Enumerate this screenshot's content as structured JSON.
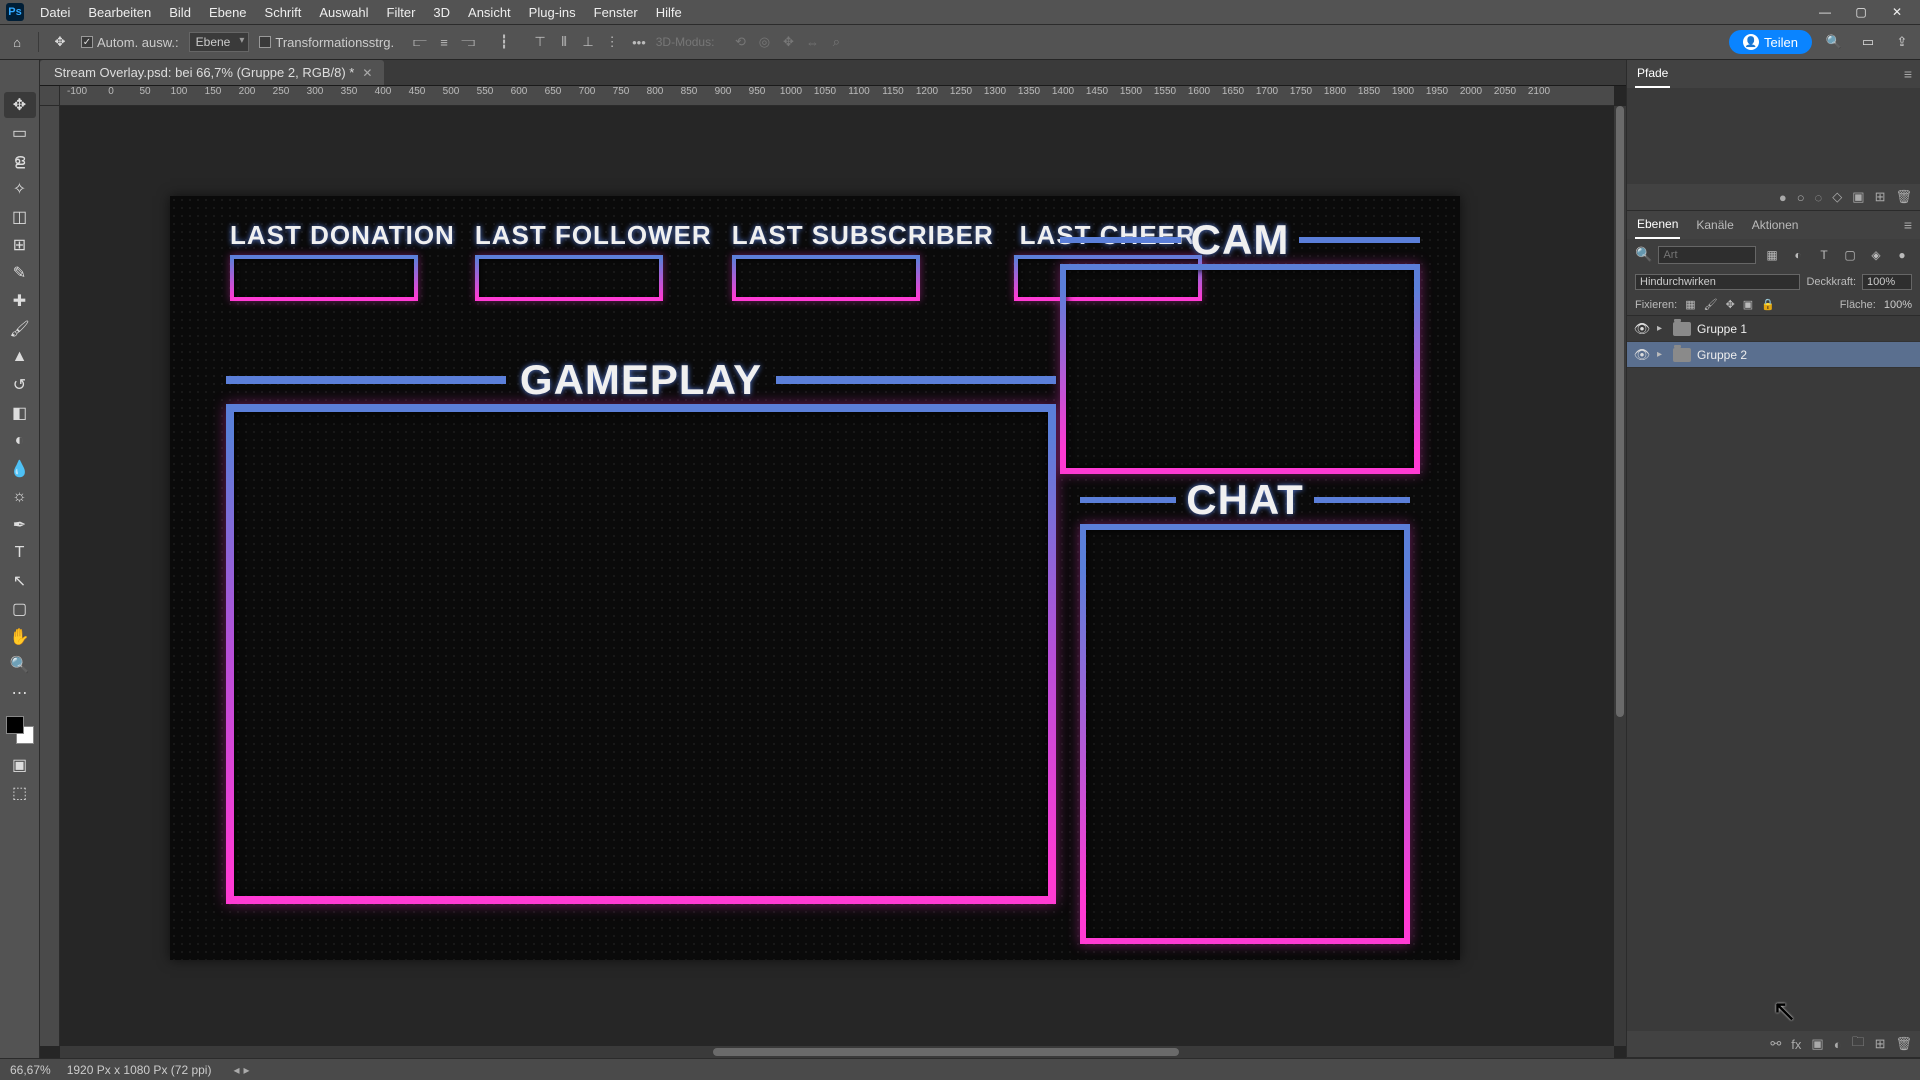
{
  "menubar": {
    "items": [
      "Datei",
      "Bearbeiten",
      "Bild",
      "Ebene",
      "Schrift",
      "Auswahl",
      "Filter",
      "3D",
      "Ansicht",
      "Plug-ins",
      "Fenster",
      "Hilfe"
    ]
  },
  "optbar": {
    "auto_select_label": "Autom. ausw.:",
    "auto_select_value": "Ebene",
    "transform_label": "Transformationsstrg.",
    "mode_3d": "3D-Modus:"
  },
  "share_label": "Teilen",
  "doc_tab": "Stream Overlay.psd: bei 66,7% (Gruppe 2, RGB/8) *",
  "ruler_marks": [
    "-100",
    "0",
    "50",
    "100",
    "150",
    "200",
    "250",
    "300",
    "350",
    "400",
    "450",
    "500",
    "550",
    "600",
    "650",
    "700",
    "750",
    "800",
    "850",
    "900",
    "950",
    "1000",
    "1050",
    "1100",
    "1150",
    "1200",
    "1250",
    "1300",
    "1350",
    "1400",
    "1450",
    "1500",
    "1550",
    "1600",
    "1650",
    "1700",
    "1750",
    "1800",
    "1850",
    "1900",
    "1950",
    "2000",
    "2050",
    "2100"
  ],
  "overlay": {
    "info": [
      "LAST DONATION",
      "LAST FOLLOWER",
      "LAST SUBSCRIBER",
      "LAST CHEER"
    ],
    "gameplay": "GAMEPLAY",
    "cam": "CAM",
    "chat": "CHAT"
  },
  "panels": {
    "paths_tab": "Pfade",
    "layers_tabs": [
      "Ebenen",
      "Kanäle",
      "Aktionen"
    ],
    "filter_placeholder": "Art",
    "blend_mode": "Hindurchwirken",
    "opacity_label": "Deckkraft:",
    "opacity_value": "100%",
    "fill_label": "Fläche:",
    "fill_value": "100%",
    "lock_label": "Fixieren:",
    "layers": [
      {
        "name": "Gruppe 1",
        "selected": false
      },
      {
        "name": "Gruppe 2",
        "selected": true
      }
    ]
  },
  "status": {
    "zoom": "66,67%",
    "doc_info": "1920 Px x 1080 Px (72 ppi)"
  }
}
